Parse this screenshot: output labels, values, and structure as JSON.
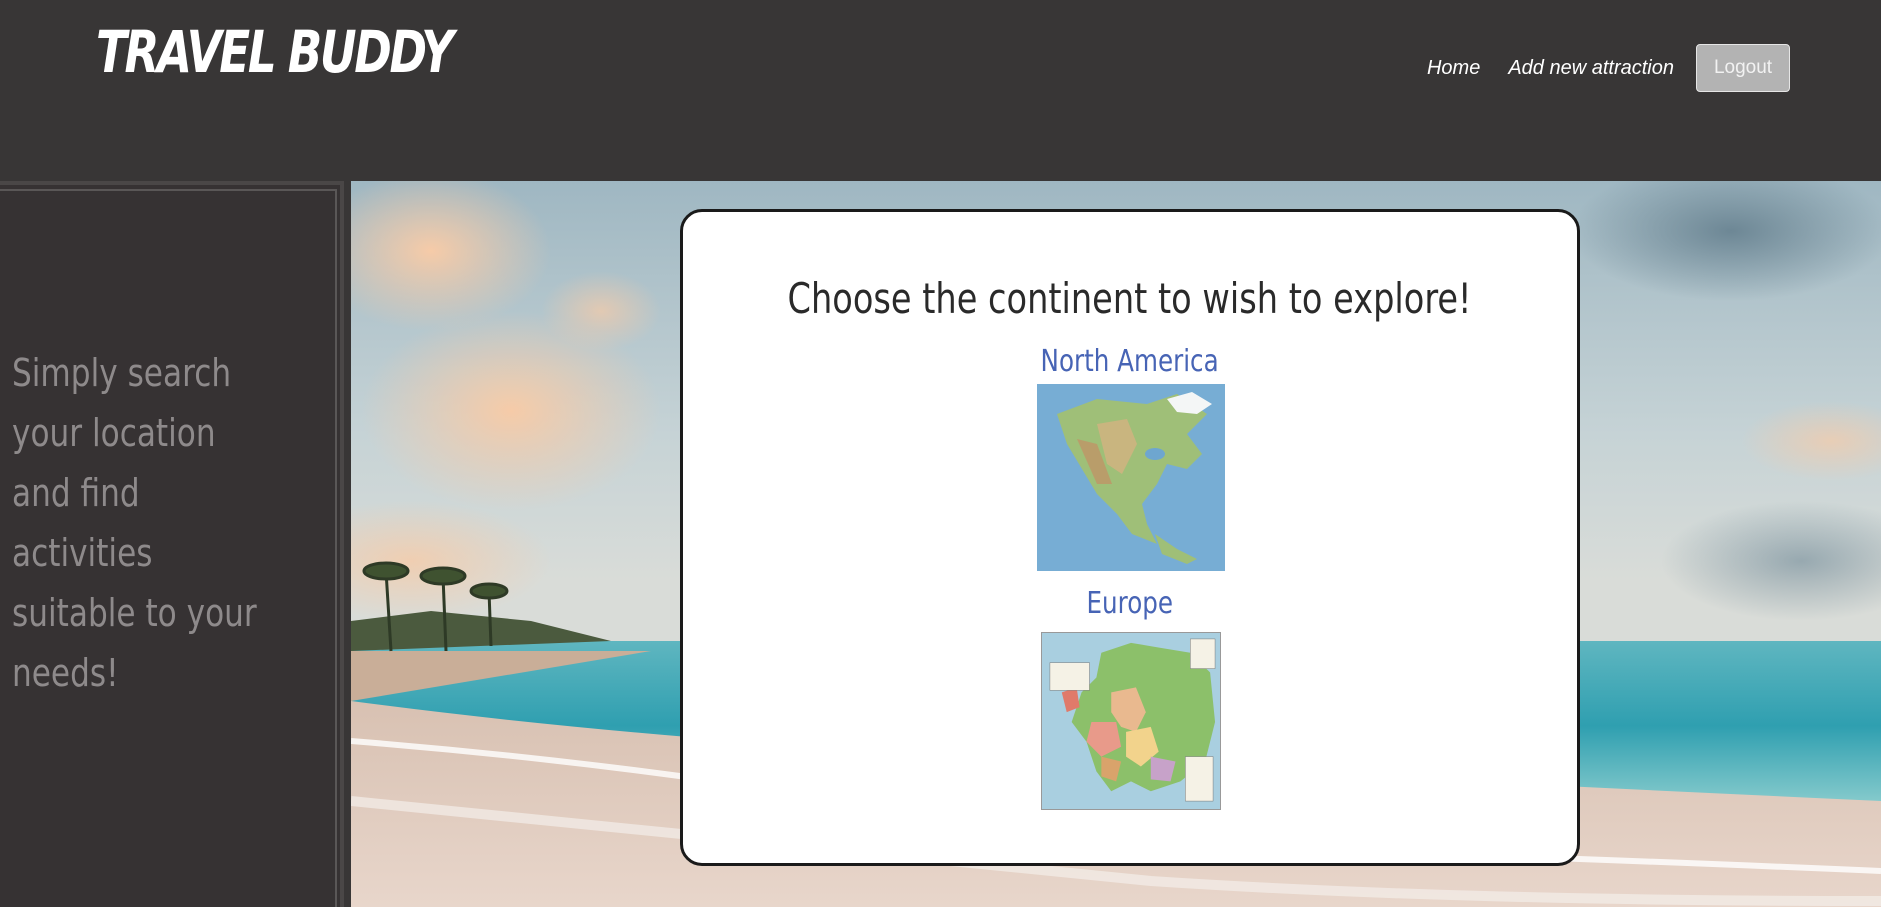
{
  "header": {
    "logo": "TRAVEL BUDDY",
    "nav": {
      "home": "Home",
      "add_attraction": "Add new attraction",
      "logout": "Logout"
    }
  },
  "sidebar": {
    "tagline": "Simply search your location and find activities suitable to your needs!"
  },
  "main": {
    "title": "Choose the continent to wish to explore!",
    "continents": [
      {
        "label": "North America"
      },
      {
        "label": "Europe"
      }
    ]
  },
  "colors": {
    "header_bg": "#383636",
    "link_blue": "#4764b5",
    "sidebar_text": "#8e8a8b"
  }
}
